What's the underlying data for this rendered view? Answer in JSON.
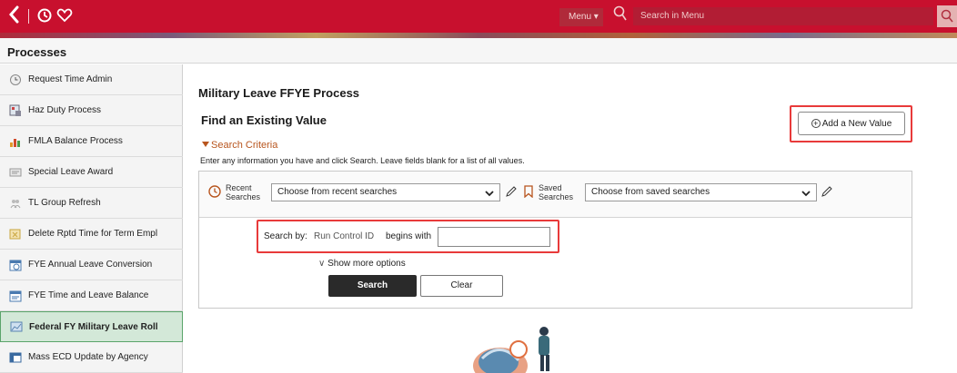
{
  "topbar": {
    "menu_label": "Menu",
    "menu_search_placeholder": "Search in Menu"
  },
  "processes_header": "Processes",
  "sidebar": {
    "items": [
      {
        "label": "Request Time Admin",
        "icon": "clock-icon",
        "active": false
      },
      {
        "label": "Haz Duty Process",
        "icon": "grid-document-icon",
        "active": false
      },
      {
        "label": "FMLA Balance Process",
        "icon": "bar-chart-icon",
        "active": false
      },
      {
        "label": "Special Leave Award",
        "icon": "award-document-icon",
        "active": false
      },
      {
        "label": "TL Group Refresh",
        "icon": "group-refresh-icon",
        "active": false
      },
      {
        "label": "Delete Rptd Time for Term Empl",
        "icon": "delete-time-icon",
        "active": false
      },
      {
        "label": "FYE Annual Leave Conversion",
        "icon": "calendar-clock-icon",
        "active": false
      },
      {
        "label": "FYE Time and Leave Balance",
        "icon": "calendar-icon",
        "active": false
      },
      {
        "label": "Federal FY Military Leave Roll",
        "icon": "leave-roll-icon",
        "active": true
      },
      {
        "label": "Mass ECD Update by Agency",
        "icon": "window-icon",
        "active": false
      }
    ]
  },
  "main": {
    "page_title": "Military Leave FFYE Process",
    "find_title": "Find an Existing Value",
    "add_button_label": "Add a New Value",
    "criteria_label": "Search Criteria",
    "instructions": "Enter any information you have and click Search. Leave fields blank for a list of all values.",
    "recent_label_line1": "Recent",
    "recent_label_line2": "Searches",
    "recent_value": "Choose from recent searches",
    "saved_label_line1": "Saved",
    "saved_label_line2": "Searches",
    "saved_value": "Choose from saved searches",
    "search_by_label": "Search by:",
    "field_label": "Run Control ID",
    "operator_label": "begins with",
    "run_control_value": "",
    "more_options_label": "Show more options",
    "search_button": "Search",
    "clear_button": "Clear"
  },
  "colors": {
    "brand_red": "#c8102e",
    "criteria_orange": "#b8551e",
    "highlight_red": "#e83a3a",
    "active_green": "#d3e8d8"
  }
}
